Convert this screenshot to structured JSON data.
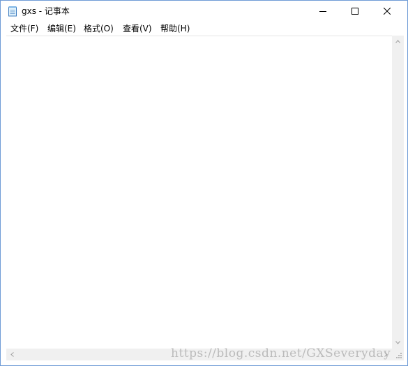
{
  "window": {
    "title": "gxs - 记事本"
  },
  "caption_buttons": {
    "minimize": "minimize-icon",
    "maximize": "maximize-icon",
    "close": "close-icon"
  },
  "menu": [
    {
      "label": "文件(F)"
    },
    {
      "label": "编辑(E)"
    },
    {
      "label": "格式(O)"
    },
    {
      "label": "查看(V)"
    },
    {
      "label": "帮助(H)"
    }
  ],
  "editor": {
    "text": ""
  },
  "watermark": {
    "text": "https://blog.csdn.net/GXSeveryday"
  },
  "colors": {
    "window_border": "#6f9bd6",
    "scrollbar_track": "#f0f0f0",
    "background": "#ffffff"
  }
}
